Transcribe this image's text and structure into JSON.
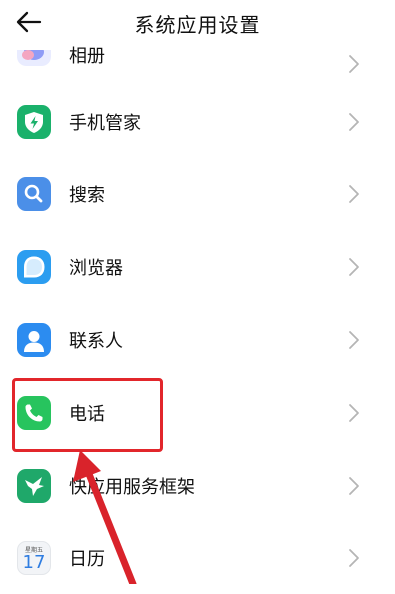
{
  "header": {
    "title": "系统应用设置"
  },
  "items": [
    {
      "label": "相册"
    },
    {
      "label": "手机管家"
    },
    {
      "label": "搜索"
    },
    {
      "label": "浏览器"
    },
    {
      "label": "联系人"
    },
    {
      "label": "电话"
    },
    {
      "label": "快应用服务框架"
    },
    {
      "label": "日历"
    }
  ],
  "calendar_icon": {
    "weekday": "星期五",
    "day": "17"
  },
  "colors": {
    "highlight_box": "#e2262b",
    "annotation_arrow": "#d9232b",
    "phone_green": "#27c45e",
    "manager_green": "#1ab16b",
    "search_blue": "#4b8fe8",
    "browser_blue": "#2b9df0",
    "contacts_blue": "#2c8cf0",
    "quickapp_green": "#1fa86a"
  },
  "icons": {
    "back": "back-arrow-icon",
    "album": "album-icon",
    "phone_manager": "shield-bolt-icon",
    "search": "magnifier-icon",
    "browser": "browser-icon",
    "contacts": "contact-person-icon",
    "phone": "phone-handset-icon",
    "quick_app": "hummingbird-icon",
    "calendar": "calendar-icon",
    "chevron": "chevron-right-icon"
  }
}
